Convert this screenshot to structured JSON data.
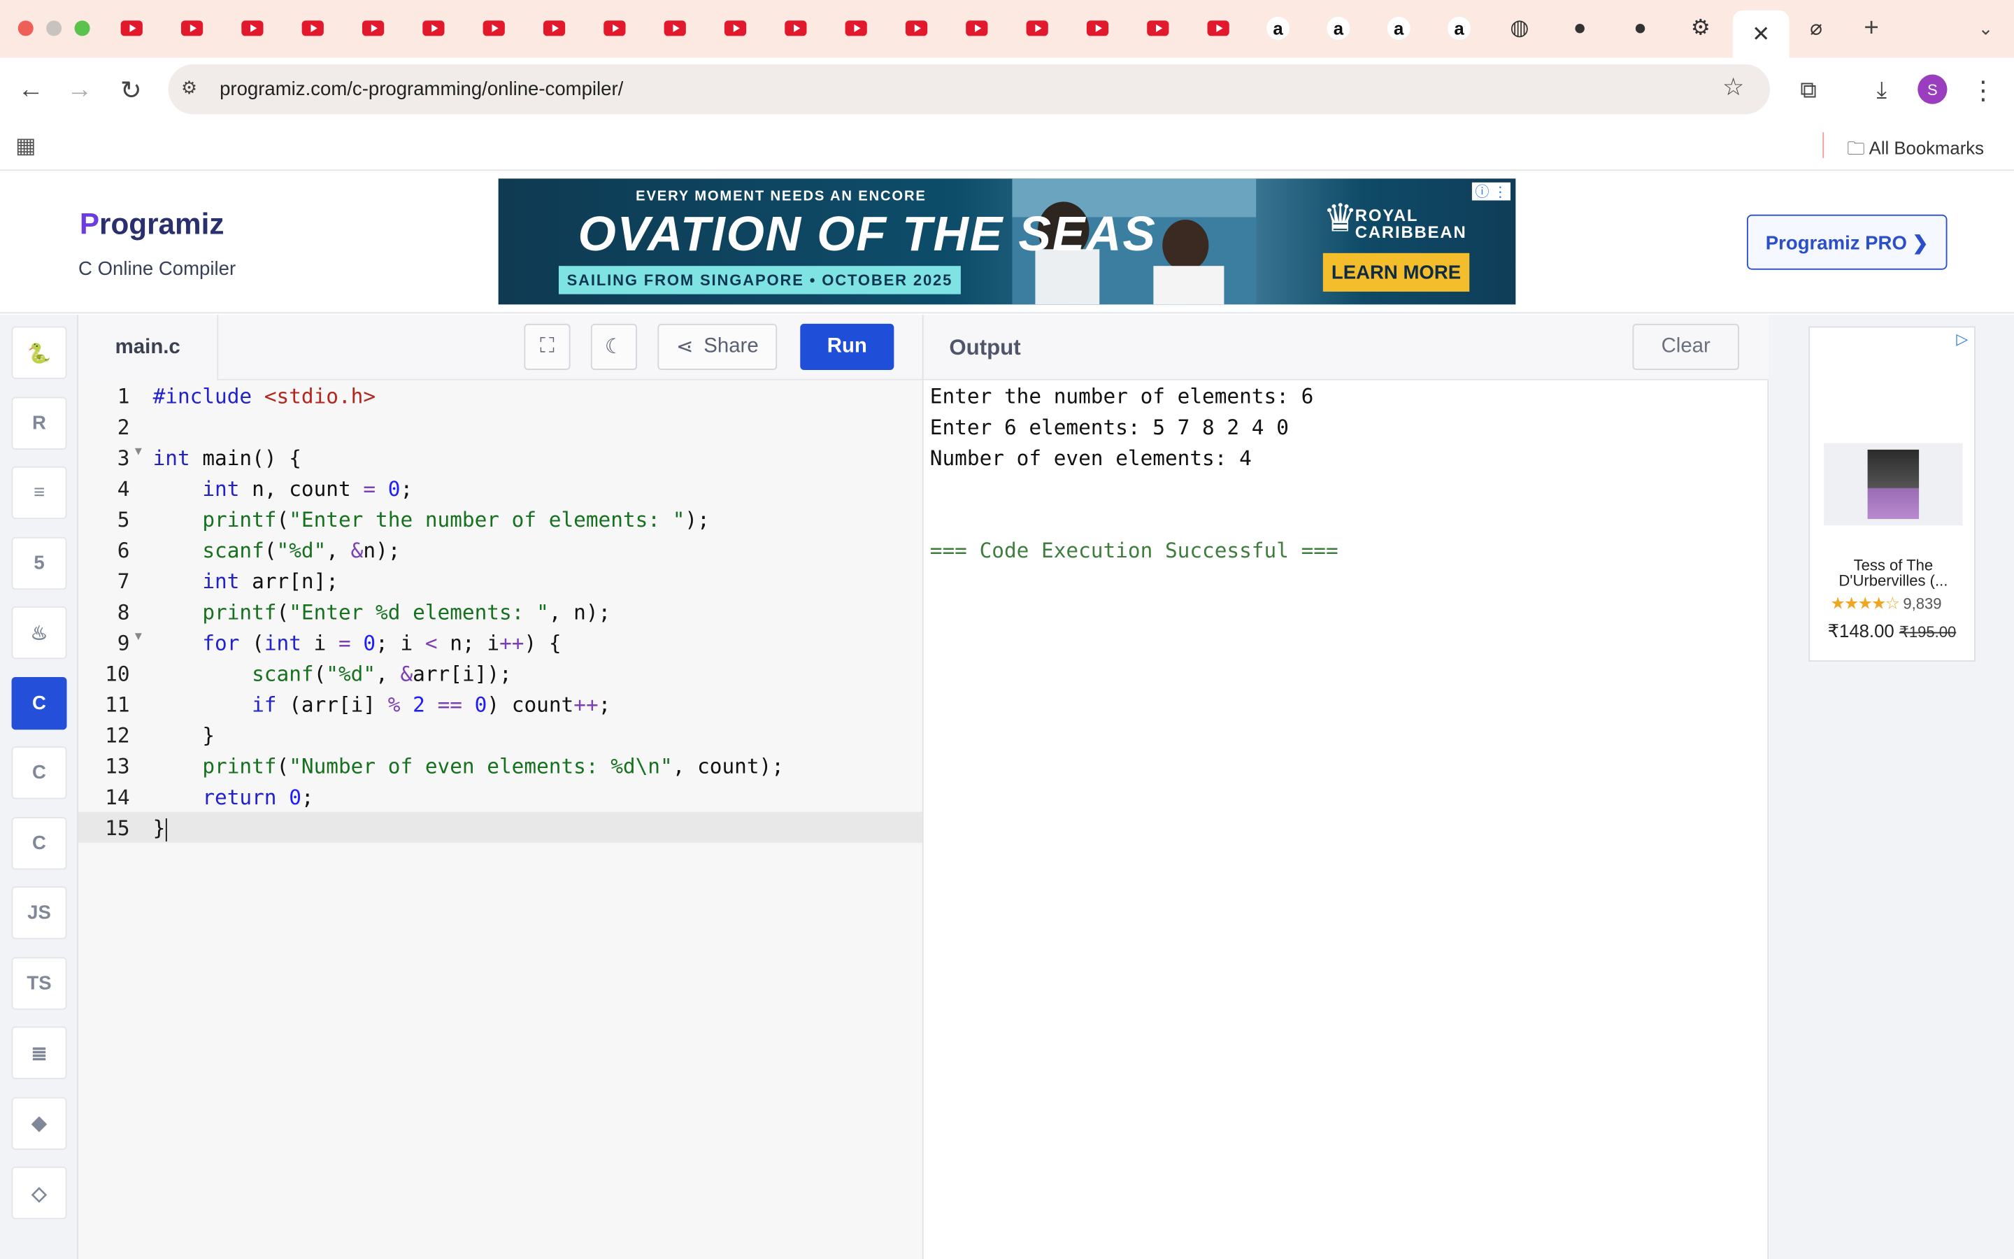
{
  "browser": {
    "url": "programiz.com/c-programming/online-compiler/",
    "bookmarks_label": "All Bookmarks",
    "avatar_letter": "S",
    "new_tab_glyph": "+",
    "close_glyph": "✕"
  },
  "header": {
    "logo_text": "rogramiz",
    "logo_letter": "P",
    "subtitle": "C Online Compiler",
    "pro_button": "Programiz PRO ❯"
  },
  "ad": {
    "tagline": "EVERY MOMENT NEEDS AN ENCORE",
    "title": "OVATION OF THE SEAS",
    "sub": "SAILING FROM SINGAPORE • OCTOBER 2025",
    "brand": "ROYAL\nCARIBBEAN",
    "cta": "LEARN MORE"
  },
  "languages": [
    {
      "name": "python",
      "label": "🐍"
    },
    {
      "name": "r",
      "label": "R"
    },
    {
      "name": "sql",
      "label": "≡"
    },
    {
      "name": "html",
      "label": "5"
    },
    {
      "name": "java",
      "label": "♨"
    },
    {
      "name": "c",
      "label": "C"
    },
    {
      "name": "cpp",
      "label": "C"
    },
    {
      "name": "csharp",
      "label": "C"
    },
    {
      "name": "js",
      "label": "JS"
    },
    {
      "name": "ts",
      "label": "TS"
    },
    {
      "name": "go",
      "label": "≣"
    },
    {
      "name": "swift",
      "label": "◆"
    },
    {
      "name": "rust",
      "label": "◇"
    }
  ],
  "editor": {
    "file_name": "main.c",
    "share_label": "Share",
    "run_label": "Run",
    "lines": [
      {
        "n": "1",
        "html": "<span class='kw'>#include</span> <span class='inc'>&lt;stdio.h&gt;</span>"
      },
      {
        "n": "2",
        "html": ""
      },
      {
        "n": "3",
        "html": "<span class='kw'>int</span> main() {",
        "fold": true
      },
      {
        "n": "4",
        "html": "    <span class='kw'>int</span> n, count <span class='op'>=</span> <span class='num'>0</span>;"
      },
      {
        "n": "5",
        "html": "    <span class='str'>printf</span>(<span class='str'>\"Enter the number of elements: \"</span>);"
      },
      {
        "n": "6",
        "html": "    <span class='str'>scanf</span>(<span class='str'>\"%d\"</span>, <span class='op'>&amp;</span>n);"
      },
      {
        "n": "7",
        "html": "    <span class='kw'>int</span> arr[n];"
      },
      {
        "n": "8",
        "html": "    <span class='str'>printf</span>(<span class='str'>\"Enter %d elements: \"</span>, n);"
      },
      {
        "n": "9",
        "html": "    <span class='kw'>for</span> (<span class='kw'>int</span> i <span class='op'>=</span> <span class='num'>0</span>; i <span class='op'>&lt;</span> n; i<span class='op'>++</span>) {",
        "fold": true
      },
      {
        "n": "10",
        "html": "        <span class='str'>scanf</span>(<span class='str'>\"%d\"</span>, <span class='op'>&amp;</span>arr[i]);"
      },
      {
        "n": "11",
        "html": "        <span class='kw'>if</span> (arr[i] <span class='op'>%</span> <span class='num'>2</span> <span class='op'>==</span> <span class='num'>0</span>) count<span class='op'>++</span>;"
      },
      {
        "n": "12",
        "html": "    }"
      },
      {
        "n": "13",
        "html": "    <span class='str'>printf</span>(<span class='str'>\"Number of even elements: %d\\n\"</span>, count);"
      },
      {
        "n": "14",
        "html": "    <span class='kw'>return</span> <span class='num'>0</span>;"
      },
      {
        "n": "15",
        "html": "}<span class='cursor'></span>",
        "active": true
      }
    ]
  },
  "output": {
    "title": "Output",
    "clear_label": "Clear",
    "lines": [
      "Enter the number of elements: 6",
      "Enter 6 elements: 5 7 8 2 4 0",
      "Number of even elements: 4",
      "",
      "",
      "=== Code Execution Successful ==="
    ]
  },
  "side_ad": {
    "title": "Tess of The D'Urbervilles (...",
    "stars": "★★★★☆",
    "reviews": "9,839",
    "price": "₹148.00",
    "old_price": "₹195.00"
  }
}
